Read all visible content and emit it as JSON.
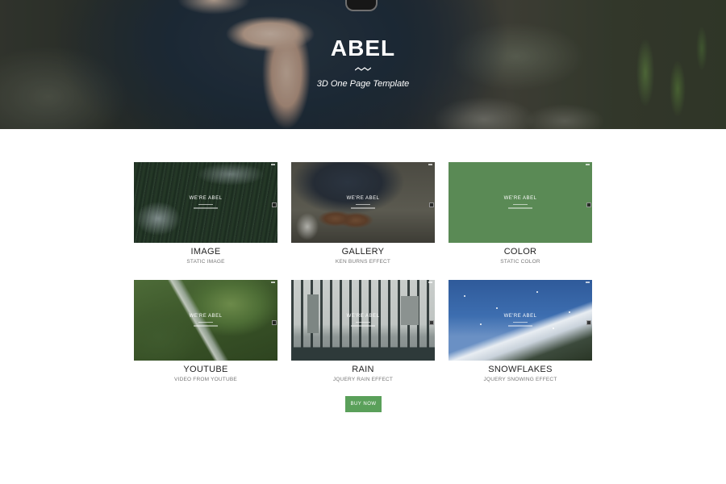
{
  "hero": {
    "title": "ABEL",
    "subtitle": "3D One Page Template"
  },
  "demos": [
    {
      "title": "IMAGE",
      "subtitle": "STATIC IMAGE",
      "thumb_caption": "WE'RE ABEL"
    },
    {
      "title": "GALLERY",
      "subtitle": "KEN BURNS EFFECT",
      "thumb_caption": "WE'RE ABEL"
    },
    {
      "title": "COLOR",
      "subtitle": "STATIC COLOR",
      "thumb_caption": "WE'RE ABEL"
    },
    {
      "title": "YOUTUBE",
      "subtitle": "VIDEO FROM YOUTUBE",
      "thumb_caption": "WE'RE ABEL"
    },
    {
      "title": "RAIN",
      "subtitle": "JQUERY RAIN EFFECT",
      "thumb_caption": "WE'RE ABEL"
    },
    {
      "title": "SNOWFLAKES",
      "subtitle": "JQUERY SNOWING EFFECT",
      "thumb_caption": "WE'RE ABEL"
    }
  ],
  "cta": {
    "label": "BUY NOW"
  },
  "colors": {
    "accent": "#5aa05a",
    "color_demo_bg": "#5a8a55"
  }
}
